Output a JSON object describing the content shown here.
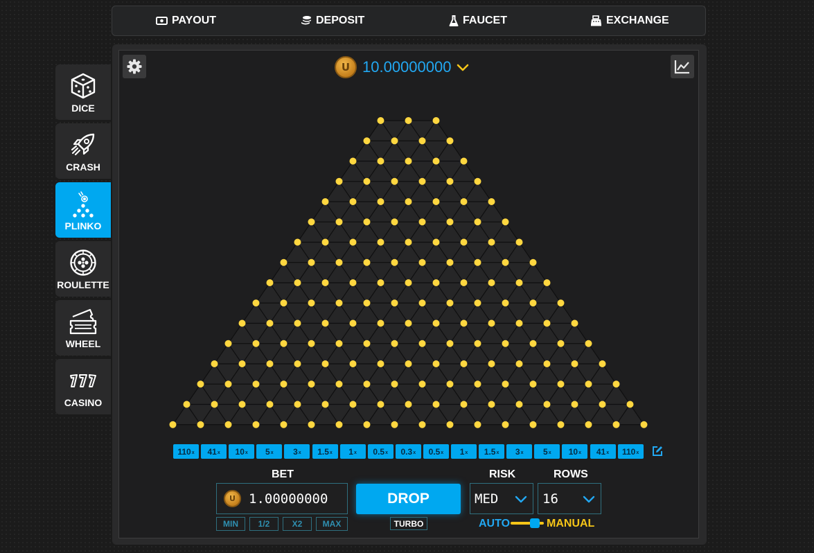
{
  "topnav": [
    {
      "label": "PAYOUT",
      "icon": "money-icon"
    },
    {
      "label": "DEPOSIT",
      "icon": "coins-icon"
    },
    {
      "label": "FAUCET",
      "icon": "flask-icon"
    },
    {
      "label": "EXCHANGE",
      "icon": "cash-register-icon"
    }
  ],
  "sidebar": [
    {
      "label": "DICE",
      "icon": "dice-icon",
      "active": false
    },
    {
      "label": "CRASH",
      "icon": "rocket-icon",
      "active": false
    },
    {
      "label": "PLINKO",
      "icon": "plinko-icon",
      "active": true
    },
    {
      "label": "ROULETTE",
      "icon": "roulette-icon",
      "active": false
    },
    {
      "label": "WHEEL",
      "icon": "ticket-icon",
      "active": false
    },
    {
      "label": "CASINO",
      "icon": "slots-777-icon",
      "active": false
    }
  ],
  "balance": {
    "amount": "10.00000000",
    "coin_letter": "U"
  },
  "board": {
    "rows": 16,
    "first_row_pins": 3
  },
  "multipliers": [
    "110",
    "41",
    "10",
    "5",
    "3",
    "1.5",
    "1",
    "0.5",
    "0.3",
    "0.5",
    "1",
    "1.5",
    "3",
    "5",
    "10",
    "41",
    "110"
  ],
  "multiplier_suffix": "x",
  "bet": {
    "label": "BET",
    "amount": "1.00000000",
    "coin_letter": "U",
    "buttons": [
      "MIN",
      "1/2",
      "X2",
      "MAX"
    ]
  },
  "drop_label": "DROP",
  "turbo_label": "TURBO",
  "risk": {
    "label": "RISK",
    "value": "MED"
  },
  "rows": {
    "label": "ROWS",
    "value": "16"
  },
  "mode": {
    "auto_label": "AUTO",
    "manual_label": "MANUAL",
    "selected": "manual"
  },
  "colors": {
    "accent": "#00a8f0",
    "pin": "#ffd740",
    "gold": "#f5c518",
    "balance_text": "#22a8f2"
  }
}
